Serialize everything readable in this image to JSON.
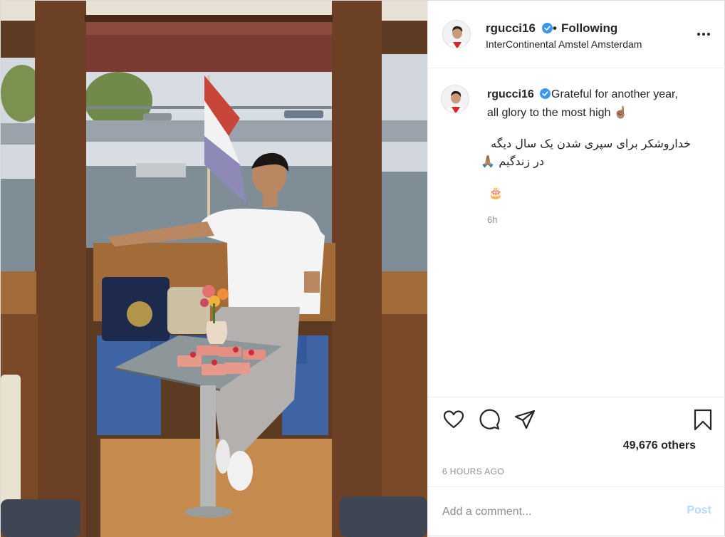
{
  "post": {
    "image_description_hidden": null
  },
  "header": {
    "username": "rgucci16",
    "follow_separator": "•",
    "follow_label": "Following",
    "location": "InterContinental Amstel Amsterdam"
  },
  "caption": {
    "username": "rgucci16",
    "line1": "Grateful for another year,",
    "line2": "all glory to the most high ☝🏽",
    "persian_line1": "خداروشکر برای سپری شدن یک سال دیگه",
    "persian_line2": "در زندگیم 🙏🏽",
    "emoji_line": "🎂",
    "time_ago": "6h"
  },
  "actions": {
    "icons": [
      "heart-icon",
      "comment-icon",
      "share-icon",
      "bookmark-icon"
    ]
  },
  "likes": {
    "text": "49,676 others"
  },
  "post_time": "6 HOURS AGO",
  "comment": {
    "placeholder": "Add a comment...",
    "post_label": "Post"
  },
  "colors": {
    "verified_blue": "#3897f0",
    "post_button_disabled": "#b3dbff",
    "muted_text": "#8e8e8e"
  }
}
